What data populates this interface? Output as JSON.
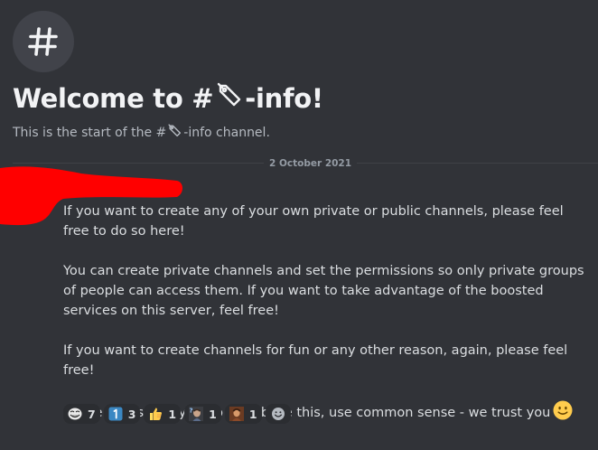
{
  "channel": {
    "name": "-info",
    "welcome_prefix": "Welcome to #",
    "welcome_suffix": "-info!",
    "start_prefix": "This is the start of the #",
    "start_suffix": "-info channel."
  },
  "divider": {
    "date": "2 October 2021"
  },
  "message": {
    "paragraphs": [
      "If you want to create any of your own private or public channels, please feel free to do so here!",
      "You can create private channels and set the permissions so only private groups of people can access them. If you want to take advantage of the boosted services on this server, feel free!",
      "If you want to create channels for fun or any other reason, again, please feel free!",
      "All we ask is that you do not abuse this, use common sense - we trust you"
    ],
    "trailing_emoji": "slightly-smiling-face"
  },
  "reactions": [
    {
      "emoji": "troll-face",
      "count": "7"
    },
    {
      "emoji": "keycap-one",
      "count": "3"
    },
    {
      "emoji": "thumbs-up",
      "count": "1"
    },
    {
      "emoji": "custom-emoji-person-question",
      "count": "1"
    },
    {
      "emoji": "custom-emoji-portrait",
      "count": "1"
    }
  ],
  "add_reaction": {
    "icon": "add-reaction-icon"
  },
  "colors": {
    "background": "#313338",
    "text_primary": "#dbdee1",
    "text_muted": "#b5bac1",
    "heading": "#f2f3f5",
    "reaction_bg": "#2b2d31",
    "redaction": "#ff0000"
  }
}
